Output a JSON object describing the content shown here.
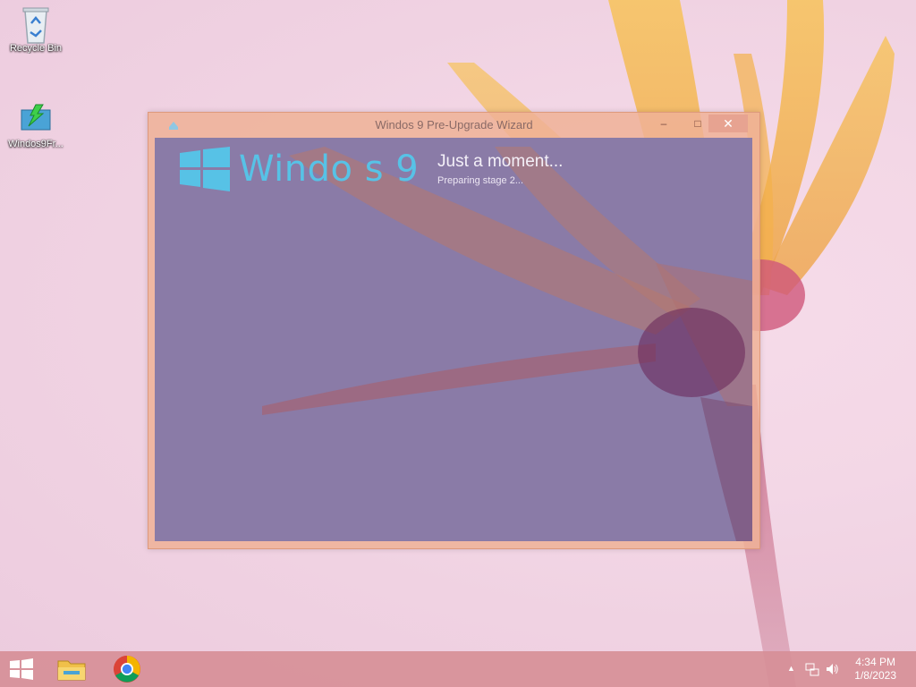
{
  "desktop": {
    "icons": [
      {
        "label": "Recycle Bin",
        "icon": "recycle-bin-icon"
      },
      {
        "label": "Windos9Fr...",
        "icon": "installer-icon"
      }
    ]
  },
  "window": {
    "title": "Windos 9 Pre-Upgrade Wizard",
    "logo_text": "Windo   s 9",
    "status_main": "Just a moment...",
    "status_sub": "Preparing stage 2...",
    "buttons": {
      "minimize": "–",
      "maximize": "□",
      "close": "✕"
    }
  },
  "taskbar": {
    "pinned": [
      {
        "name": "start",
        "icon": "windows-logo-icon"
      },
      {
        "name": "file-explorer",
        "icon": "folder-icon"
      },
      {
        "name": "chrome",
        "icon": "chrome-icon"
      }
    ],
    "tray": {
      "show_hidden": "▲",
      "time": "4:34 PM",
      "date": "1/8/2023"
    }
  },
  "colors": {
    "accent_blue": "#57c2e6",
    "window_frame": "#eeb296",
    "taskbar": "#d68e96",
    "client_bg": "#8a7ba7"
  }
}
